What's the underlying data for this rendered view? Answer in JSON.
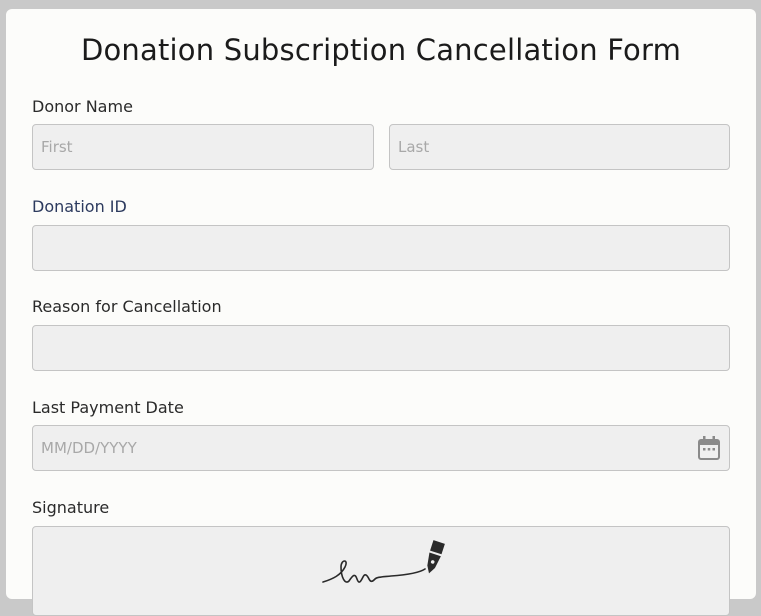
{
  "form": {
    "title": "Donation Subscription Cancellation Form",
    "donor_name": {
      "label": "Donor Name",
      "first_placeholder": "First",
      "last_placeholder": "Last"
    },
    "donation_id": {
      "label": "Donation ID",
      "value": ""
    },
    "reason": {
      "label": "Reason for Cancellation",
      "value": ""
    },
    "last_payment_date": {
      "label": "Last Payment Date",
      "placeholder": "MM/DD/YYYY",
      "icon": "calendar-icon"
    },
    "signature": {
      "label": "Signature",
      "icon": "signature-pen-icon"
    }
  },
  "colors": {
    "background": "#c9c9c9",
    "card": "#fcfcfa",
    "field_bg": "#efefef",
    "field_border": "#c4c4c4",
    "accent_label": "#2c3a5e"
  }
}
